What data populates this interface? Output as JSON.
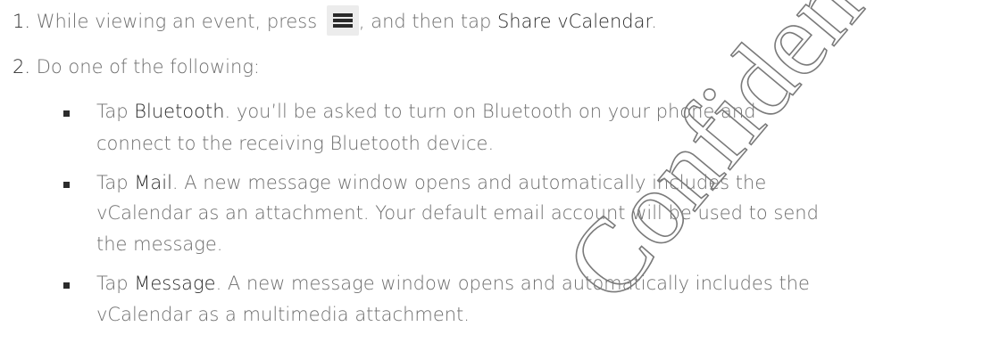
{
  "steps": [
    {
      "number": "1.",
      "pre": "While viewing an event, press",
      "icon": "menu-icon",
      "mid": ", and then tap",
      "bold": "Share vCalendar",
      "post": "."
    },
    {
      "number": "2.",
      "text": "Do one of the following:"
    }
  ],
  "options": [
    {
      "bold": "Bluetooth",
      "lines": [
        ". you’ll be asked to turn on Bluetooth on your phone and",
        "connect to the receiving Bluetooth device."
      ]
    },
    {
      "bold": "Mail",
      "lines": [
        ". A new message window opens and automatically includes the",
        "vCalendar as an attachment. Your default email account will be used to send",
        "the message."
      ]
    },
    {
      "bold": "Message",
      "lines": [
        ". A new message window opens and automatically includes the",
        "vCalendar as a multimedia attachment."
      ]
    }
  ],
  "tap_word": "Tap",
  "watermark": "Confidential"
}
